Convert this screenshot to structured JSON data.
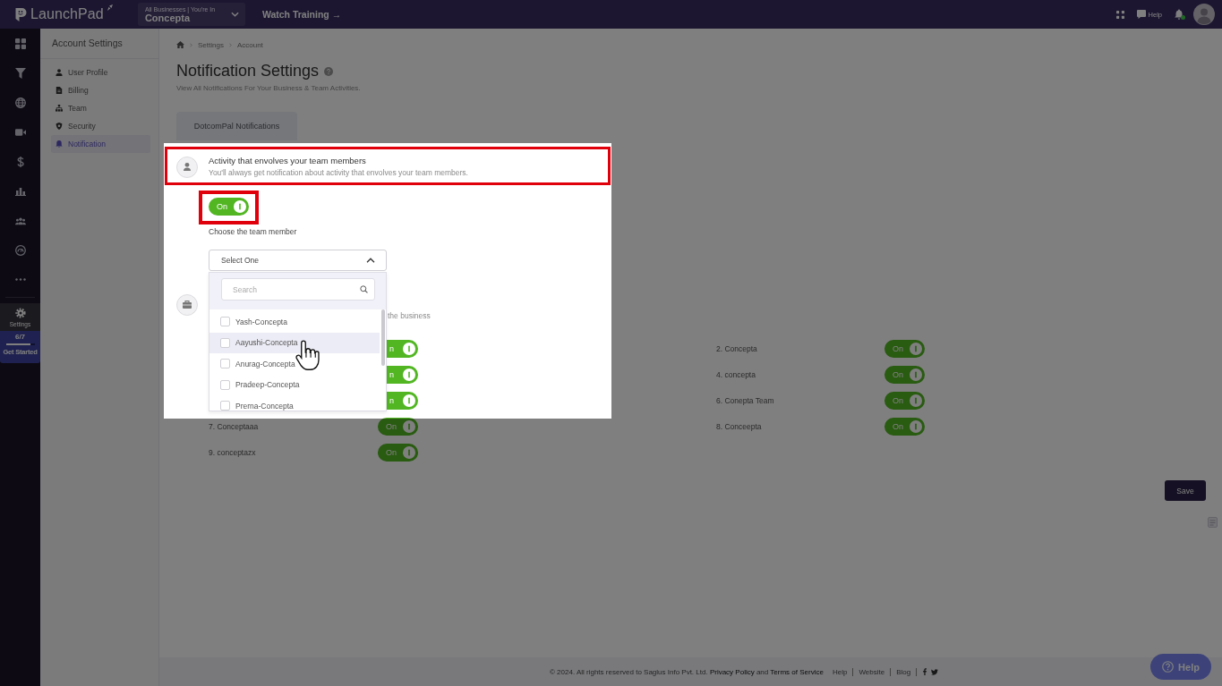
{
  "tour_overlay": true,
  "top_bar": {
    "logo": "LaunchPad",
    "workspace": {
      "caption": "All Businesses | You're In",
      "name": "Concepta"
    },
    "watch_training": "Watch Training →",
    "help": "Help",
    "unread": true
  },
  "side_rail": {
    "items": [
      {
        "selected": false
      },
      {
        "selected": false
      },
      {
        "selected": false
      },
      {
        "selected": false
      },
      {
        "selected": false
      },
      {
        "selected": false
      },
      {
        "selected": false
      },
      {
        "selected": false
      },
      {
        "selected": false
      },
      {
        "label": "Settings",
        "selected": true
      }
    ]
  },
  "onboarding": {
    "progress": "6/7",
    "level": 0.86,
    "label": "Get Started"
  },
  "account_sidebar": {
    "title": "Account Settings",
    "items": [
      {
        "label": "User Profile",
        "selected": false
      },
      {
        "label": "Billing",
        "selected": false
      },
      {
        "label": "Team",
        "selected": false
      },
      {
        "label": "Security",
        "selected": false
      },
      {
        "label": "Notification",
        "selected": true
      }
    ]
  },
  "breadcrumb": [
    "Settings",
    "Account"
  ],
  "page": {
    "title": "Notification Settings",
    "subtitle": "View All Notifications For Your Business & Team Activities."
  },
  "tabs": [
    {
      "label": "DotcomPal Notifications",
      "selected": true
    }
  ],
  "team_activity": {
    "annotated": true,
    "title": "Activity that envolves your team members",
    "description": "You'll always get notification about activity that envolves your team members.",
    "toggle": {
      "label": "On",
      "on": true,
      "annotated": true
    },
    "picker": {
      "label": "Choose the team member",
      "value": "Select One",
      "expanded": true,
      "search_placeholder": "Search",
      "options": [
        {
          "label": "Yash-Concepta",
          "checked": false,
          "highlighted": false
        },
        {
          "label": "Aayushi-Concepta",
          "checked": false,
          "highlighted": true
        },
        {
          "label": "Anurag-Concepta",
          "checked": false,
          "highlighted": false
        },
        {
          "label": "Pradeep-Concepta",
          "checked": false,
          "highlighted": false
        },
        {
          "label": "Prerna-Concepta",
          "checked": false,
          "highlighted": false
        }
      ]
    }
  },
  "business_activity": {
    "description": "the business",
    "items": [
      {
        "kind": "covered",
        "toggle": "n",
        "on": true
      },
      {
        "kind": "full",
        "label": "2. Concepta",
        "toggle": "On",
        "on": true
      },
      {
        "kind": "covered",
        "toggle": "n",
        "on": true
      },
      {
        "kind": "full",
        "label": "4. concepta",
        "toggle": "On",
        "on": true
      },
      {
        "kind": "covered",
        "toggle": "n",
        "on": true
      },
      {
        "kind": "full",
        "label": "6. Conepta Team",
        "toggle": "On",
        "on": true
      },
      {
        "kind": "full",
        "label": "7. Conceptaaa",
        "toggle": "On",
        "on": true
      },
      {
        "kind": "full",
        "label": "8. Conceepta",
        "toggle": "On",
        "on": true
      },
      {
        "kind": "full",
        "label": "9. conceptazx",
        "toggle": "On",
        "on": true
      }
    ]
  },
  "save_button": "Save",
  "footer": {
    "copyright": "© 2024. All rights reserved to Saglus Info Pvt. Ltd.",
    "privacy": "Privacy Policy",
    "and": "and",
    "terms": "Terms of Service",
    "links": [
      "Help",
      "Website",
      "Blog"
    ]
  },
  "help_button": "Help"
}
